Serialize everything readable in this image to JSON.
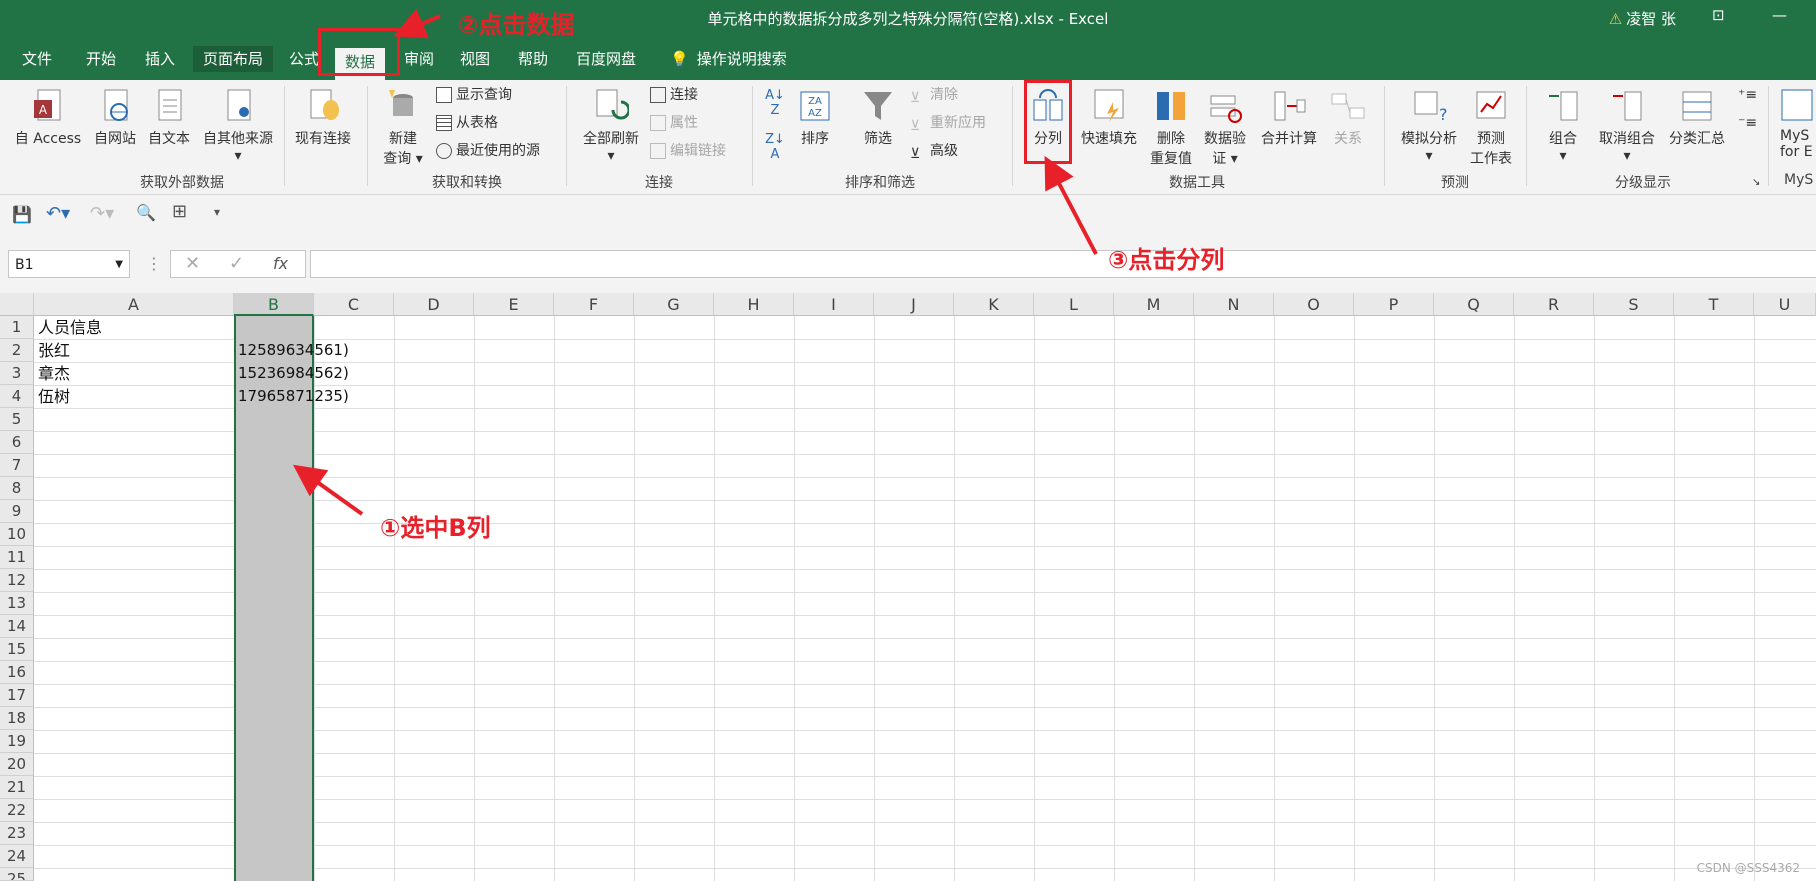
{
  "window": {
    "title": "单元格中的数据拆分成多列之特殊分隔符(空格).xlsx  -  Excel",
    "user": "凌智 张"
  },
  "tabs": [
    "文件",
    "开始",
    "插入",
    "页面布局",
    "公式",
    "数据",
    "审阅",
    "视图",
    "帮助",
    "百度网盘",
    "操作说明搜索"
  ],
  "ribbon": {
    "get_external": {
      "label": "获取外部数据",
      "access": "自 Access",
      "web": "自网站",
      "text": "自文本",
      "other": "自其他来源",
      "existing": "现有连接"
    },
    "get_transform": {
      "label": "获取和转换",
      "new_query_1": "新建",
      "new_query_2": "查询",
      "show_query": "显示查询",
      "from_table": "从表格",
      "recent": "最近使用的源"
    },
    "connections": {
      "label": "连接",
      "refresh_all": "全部刷新",
      "connections": "连接",
      "properties": "属性",
      "edit_links": "编辑链接"
    },
    "sort_filter": {
      "label": "排序和筛选",
      "sort": "排序",
      "filter": "筛选",
      "clear": "清除",
      "reapply": "重新应用",
      "advanced": "高级"
    },
    "data_tools": {
      "label": "数据工具",
      "text_to_columns": "分列",
      "flash_fill": "快速填充",
      "remove_dup_1": "删除",
      "remove_dup_2": "重复值",
      "validation_1": "数据验",
      "validation_2": "证",
      "consolidate": "合并计算",
      "relations": "关系"
    },
    "forecast": {
      "label": "预测",
      "what_if": "模拟分析",
      "sheet_1": "预测",
      "sheet_2": "工作表"
    },
    "outline": {
      "label": "分级显示",
      "group": "组合",
      "ungroup": "取消组合",
      "subtotal": "分类汇总"
    },
    "mysql": {
      "line1": "MyS",
      "line2": "for E",
      "label": "MyS"
    }
  },
  "namebox": "B1",
  "columns": [
    "A",
    "B",
    "C",
    "D",
    "E",
    "F",
    "G",
    "H",
    "I",
    "J",
    "K",
    "L",
    "M",
    "N",
    "O",
    "P",
    "Q",
    "R",
    "S",
    "T",
    "U"
  ],
  "rows": [
    "1",
    "2",
    "3",
    "4",
    "5",
    "6",
    "7",
    "8",
    "9",
    "10",
    "11",
    "12",
    "13",
    "14",
    "15",
    "16",
    "17",
    "18",
    "19",
    "20",
    "21",
    "22",
    "23",
    "24",
    "25"
  ],
  "cells": {
    "a1": "人员信息",
    "a2": "张红",
    "b2": "12589634561)",
    "a3": "章杰",
    "b3": "15236984562)",
    "a4": "伍树",
    "b4": "17965871235)"
  },
  "annotations": {
    "step1": "①选中B列",
    "step2": "②点击数据",
    "step3": "③点击分列"
  },
  "watermark": "CSDN @SSS4362",
  "colors": {
    "excel_green": "#217346",
    "annotation_red": "#e8202a",
    "selection": "#c6c6c6"
  }
}
